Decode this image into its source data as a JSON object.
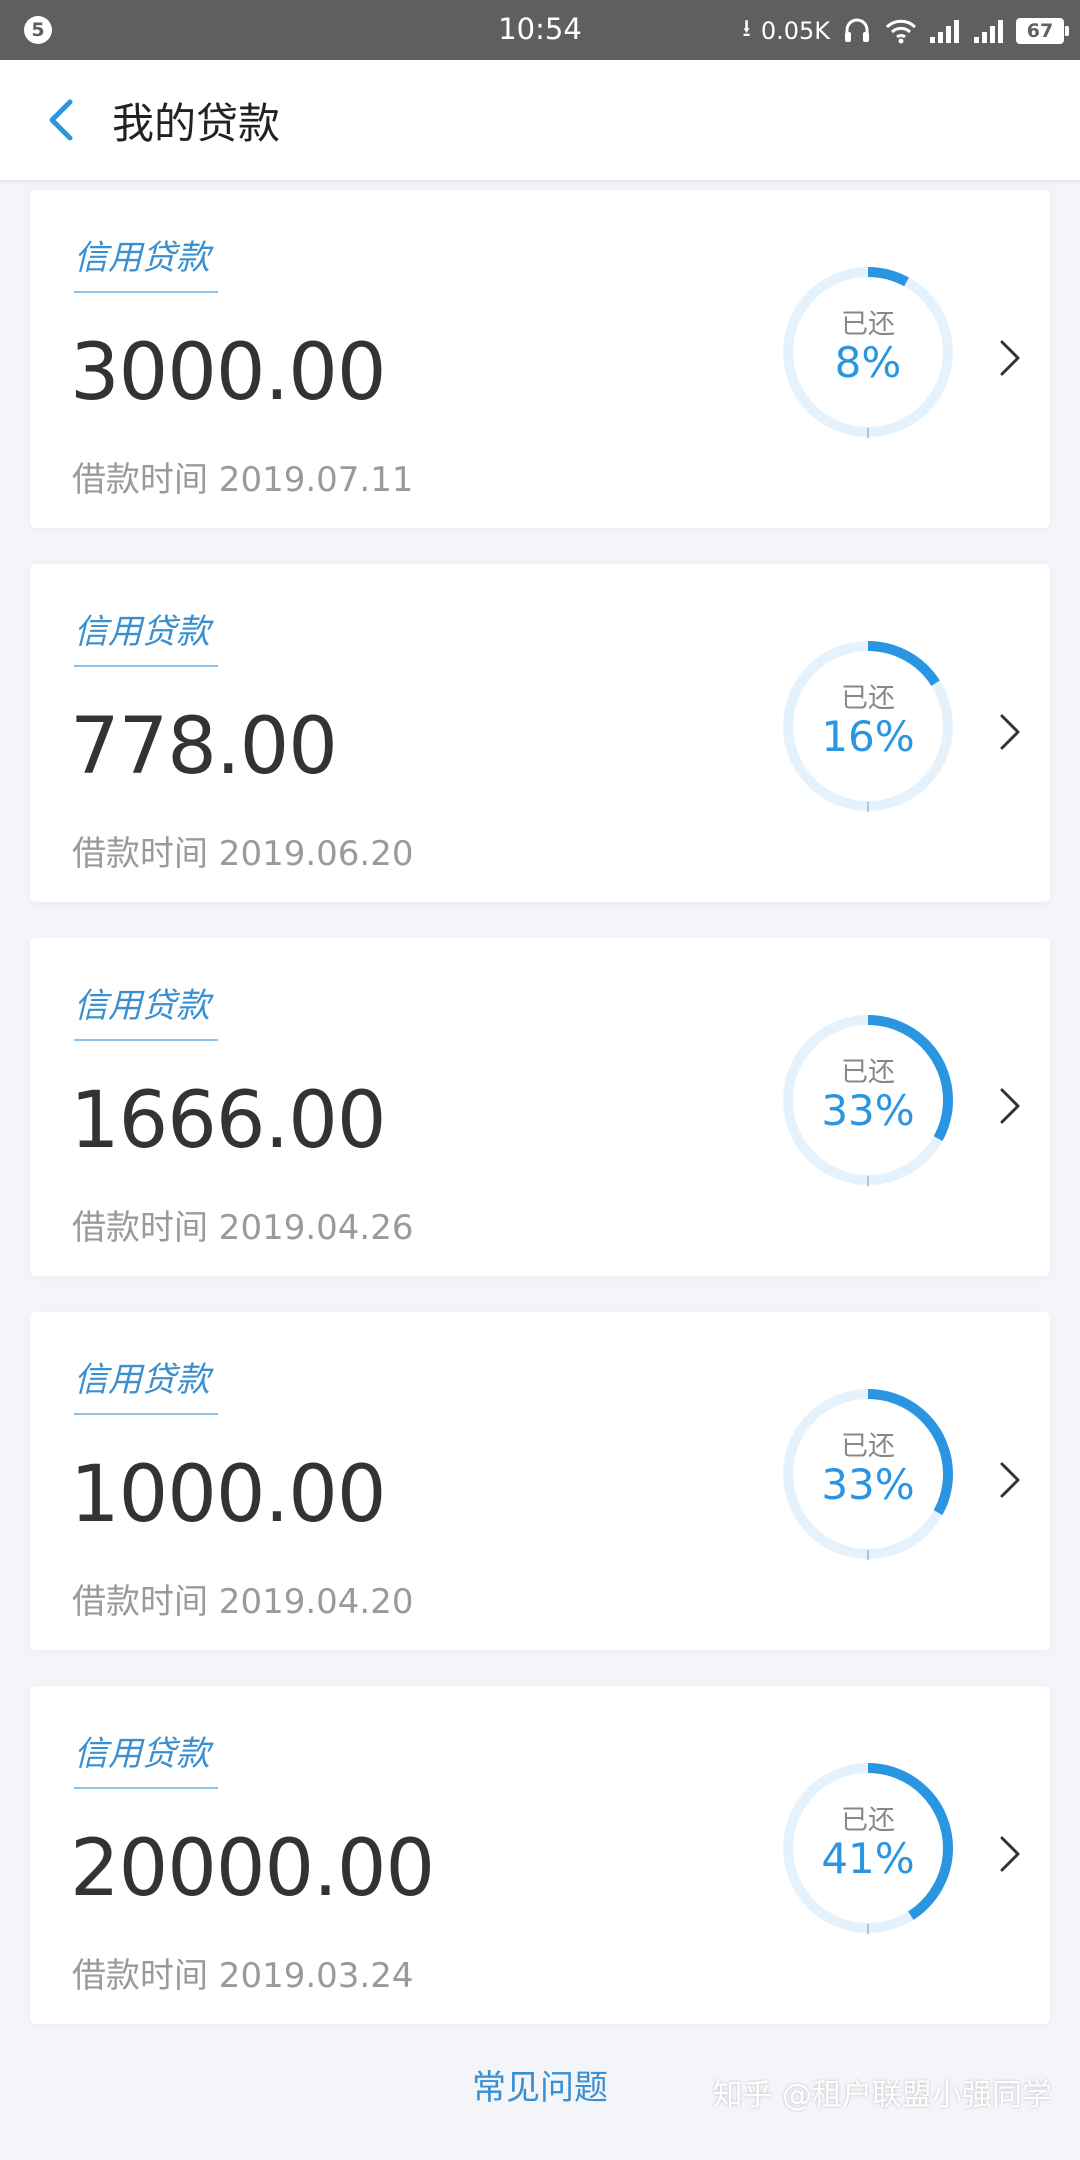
{
  "status_bar": {
    "notification_count": "5",
    "time": "10:54",
    "network_speed": "0.05K",
    "battery": "67"
  },
  "header": {
    "title": "我的贷款"
  },
  "loans": [
    {
      "type": "信用贷款",
      "amount": "3000.00",
      "date_label": "借款时间 2019.07.11",
      "repaid_label": "已还",
      "repaid_percent": "8%",
      "progress": 0.08
    },
    {
      "type": "信用贷款",
      "amount": "778.00",
      "date_label": "借款时间 2019.06.20",
      "repaid_label": "已还",
      "repaid_percent": "16%",
      "progress": 0.16
    },
    {
      "type": "信用贷款",
      "amount": "1666.00",
      "date_label": "借款时间 2019.04.26",
      "repaid_label": "已还",
      "repaid_percent": "33%",
      "progress": 0.33
    },
    {
      "type": "信用贷款",
      "amount": "1000.00",
      "date_label": "借款时间 2019.04.20",
      "repaid_label": "已还",
      "repaid_percent": "33%",
      "progress": 0.33
    },
    {
      "type": "信用贷款",
      "amount": "20000.00",
      "date_label": "借款时间 2019.03.24",
      "repaid_label": "已还",
      "repaid_percent": "41%",
      "progress": 0.41
    }
  ],
  "footer": {
    "faq_link": "常见问题",
    "watermark": "知乎 @租户联盟小强同学"
  },
  "colors": {
    "accent": "#2a95e0",
    "ring_track": "#e6f2fb",
    "status_bar": "#5f5f5f"
  }
}
